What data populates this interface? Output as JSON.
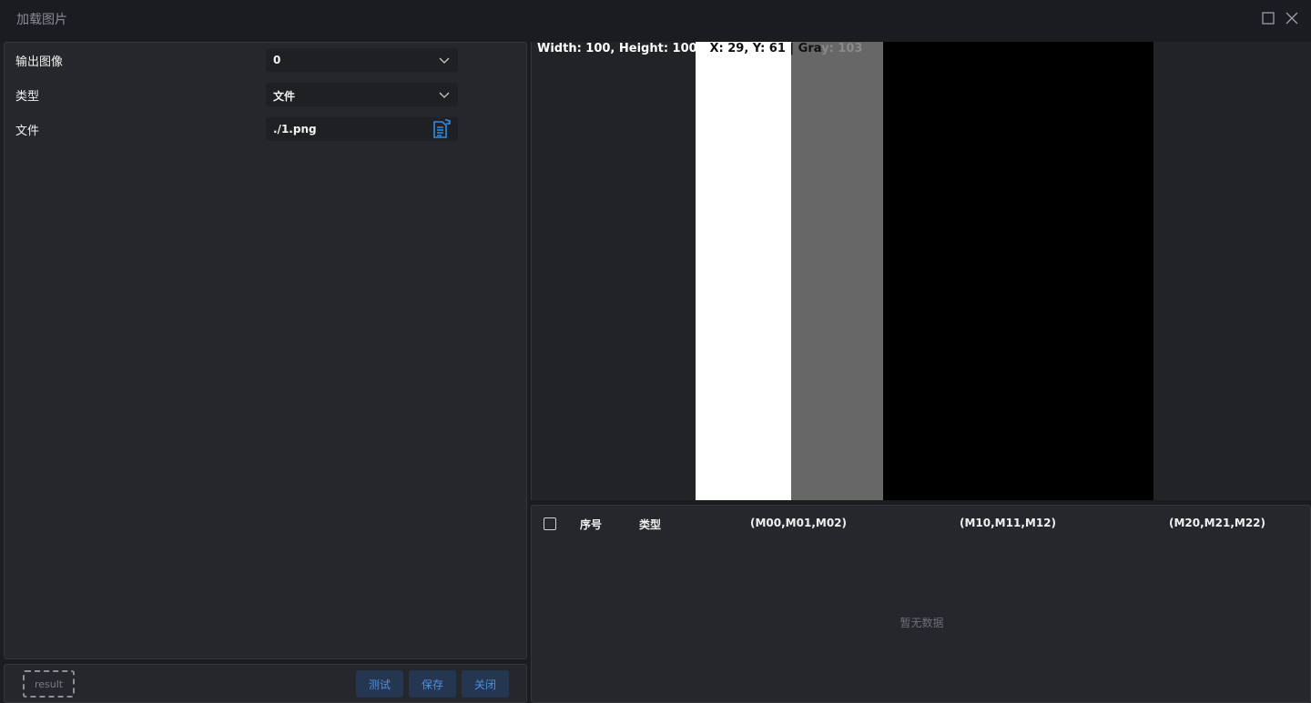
{
  "window": {
    "title": "加载图片"
  },
  "properties": [
    {
      "label": "输出图像",
      "value": "0",
      "kind": "select"
    },
    {
      "label": "类型",
      "value": "文件",
      "kind": "select"
    },
    {
      "label": "文件",
      "value": "./1.png",
      "kind": "file"
    }
  ],
  "footer": {
    "result_label": "result",
    "test_label": "测试",
    "save_label": "保存",
    "close_label": "关闭"
  },
  "viewer": {
    "info_part1": "Width: 100, Height: 100 | ",
    "info_part2": "X: 29, Y: 61 | Gra",
    "info_part3": "y: 103",
    "bars": [
      "#ffffff",
      "#676767",
      "#000000"
    ]
  },
  "table": {
    "columns": [
      "序号",
      "类型",
      "(M00,M01,M02)",
      "(M10,M11,M12)",
      "(M20,M21,M22)"
    ],
    "empty_text": "暂无数据"
  },
  "colors": {
    "accent": "#4f8fe0",
    "button_bg": "#243650",
    "file_icon": "#2f8be8"
  }
}
